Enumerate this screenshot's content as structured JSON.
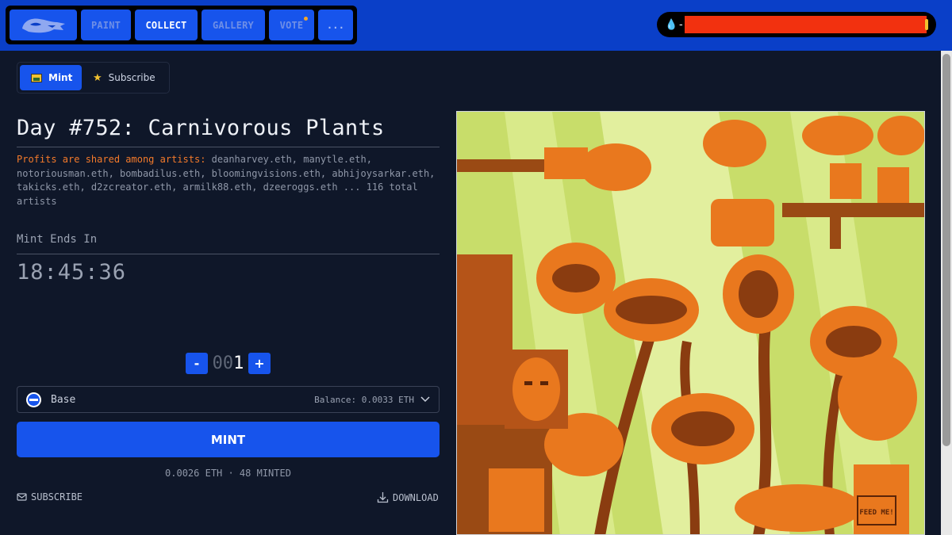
{
  "nav": {
    "items": [
      {
        "label": "PAINT"
      },
      {
        "label": "COLLECT"
      },
      {
        "label": "GALLERY"
      },
      {
        "label": "VOTE"
      },
      {
        "label": "..."
      }
    ]
  },
  "wallet": {
    "prefix": "-"
  },
  "tabs": [
    {
      "label": "Mint"
    },
    {
      "label": "Subscribe"
    }
  ],
  "drop": {
    "title": "Day #752: Carnivorous Plants",
    "profits_label": "Profits are shared among artists:",
    "profits_artists": " deanharvey.eth, manytle.eth, notoriousman.eth, bombadilus.eth, bloomingvisions.eth, abhijoysarkar.eth, takicks.eth, d2zcreator.eth, armilk88.eth, dzeeroggs.eth ... 116 total artists",
    "mint_ends_label": "Mint Ends In",
    "countdown": "18:45:36"
  },
  "quantity": {
    "prefix": "00",
    "value": "1",
    "minus": "-",
    "plus": "+"
  },
  "network": {
    "name": "Base",
    "balance": "Balance: 0.0033 ETH"
  },
  "mint_button": "MINT",
  "price_line": "0.0026 ETH · 48 MINTED",
  "footer": {
    "subscribe": "SUBSCRIBE",
    "download": "DOWNLOAD"
  },
  "artwork": {
    "sign_text": "FEED ME!"
  },
  "colors": {
    "accent": "#1754ec",
    "background": "#0f1729",
    "topbar": "#0a3fc8",
    "orange": "#f47a2a"
  }
}
